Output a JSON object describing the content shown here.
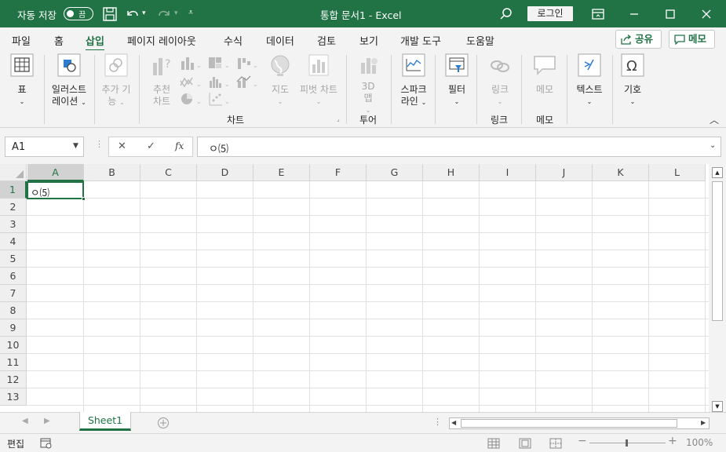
{
  "titlebar": {
    "autosave_label": "자동 저장",
    "autosave_state": "끔",
    "doc_title": "통합 문서1  -  Excel",
    "login_label": "로그인"
  },
  "tabs": [
    "파일",
    "홈",
    "삽입",
    "페이지 레이아웃",
    "수식",
    "데이터",
    "검토",
    "보기",
    "개발 도구",
    "도움말"
  ],
  "active_tab": "삽입",
  "share_label": "공유",
  "comment_label": "메모",
  "ribbon": {
    "table": "표",
    "illustrations_1": "일러스트",
    "illustrations_2": "레이션",
    "addins_1": "추가 기",
    "addins_2": "능",
    "rec_charts_1": "추천",
    "rec_charts_2": "차트",
    "maps": "지도",
    "pivot_chart": "피벗 차트",
    "charts_group": "차트",
    "map3d_1": "3D",
    "map3d_2": "맵",
    "tours_group": "투어",
    "sparklines_1": "스파크",
    "sparklines_2": "라인",
    "filters": "필터",
    "link": "링크",
    "links_group": "링크",
    "comment": "메모",
    "comments_group": "메모",
    "text": "텍스트",
    "symbols": "기호"
  },
  "formula_bar": {
    "name_box": "A1",
    "cancel_icon": "✕",
    "enter_icon": "✓",
    "fx": "fx",
    "content": "ㅇ⑸"
  },
  "columns": [
    "A",
    "B",
    "C",
    "D",
    "E",
    "F",
    "G",
    "H",
    "I",
    "J",
    "K",
    "L"
  ],
  "rows": [
    "1",
    "2",
    "3",
    "4",
    "5",
    "6",
    "7",
    "8",
    "9",
    "10",
    "11",
    "12",
    "13"
  ],
  "cell_a1": "ㅇ⑸",
  "sheet_tab": "Sheet1",
  "status": {
    "mode": "편집",
    "zoom": "100%"
  },
  "colors": {
    "accent": "#217346"
  }
}
